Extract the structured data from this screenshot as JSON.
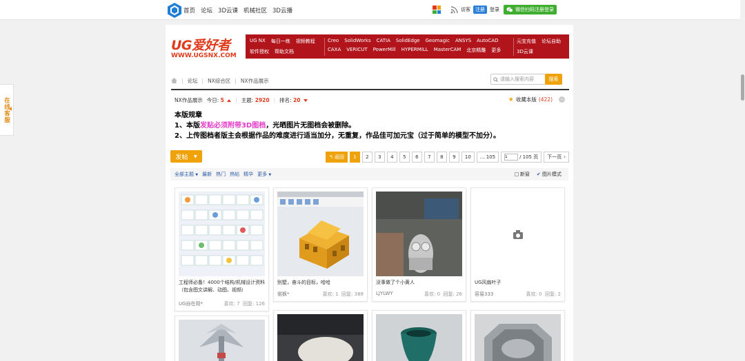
{
  "topbar": {
    "nav": [
      "首页",
      "论坛",
      "3D云课",
      "机械社区",
      "3D云播"
    ],
    "right_nav": [
      "访客",
      "注册",
      "登录"
    ],
    "wechat_label": "微信扫码注册登录"
  },
  "side_tab": {
    "label": "在线客服"
  },
  "brand": {
    "name": "UG爱好者",
    "url": "WWW.UGSNX.COM"
  },
  "redmenu": {
    "row1_a": [
      "UG NX",
      "每日一练",
      "视频教程"
    ],
    "row2_a": [
      "软件授权",
      "帮助文档"
    ],
    "row1_b": [
      "Creo",
      "SolidWorks",
      "CATIA",
      "SolidEdge",
      "Geomagic",
      "ANSYS",
      "AutoCAD"
    ],
    "row2_b": [
      "CAXA",
      "VERICUT",
      "PowerMill",
      "HYPERMILL",
      "MasterCAM",
      "北京精雕",
      "更多"
    ],
    "row1_c": [
      "元宝充值",
      "论坛自助"
    ],
    "row2_c": [
      "3D云课"
    ]
  },
  "breadcrumb": {
    "items": [
      "论坛",
      "NX综合区",
      "NX作品展示"
    ]
  },
  "search": {
    "placeholder": "请输入搜索内容",
    "button": "搜索"
  },
  "forum": {
    "name": "NX作品展示",
    "today_label": "今日:",
    "today_value": "5",
    "topics_label": "主题:",
    "topics_value": "2920",
    "rank_label": "排名:",
    "rank_value": "20",
    "fav_label": "收藏本版",
    "fav_count": "(422)"
  },
  "rules": {
    "title": "本版规章",
    "line1_pre": "1、本版",
    "line1_hl": "发贴必须附带3D图档",
    "line1_post": "，光晒图片无图档会被删除。",
    "line2": "2、上传图档者版主会根据作品的难度进行适当加分，无重复，作品佳可加元宝（过于简单的模型不加分）。"
  },
  "post_button": "发帖",
  "pager": {
    "back": "返回",
    "pages": [
      "1",
      "2",
      "3",
      "4",
      "5",
      "6",
      "7",
      "8",
      "9",
      "10",
      "... 105"
    ],
    "jump_value": "1",
    "jump_total": "/ 105 页",
    "next": "下一页"
  },
  "filter": {
    "items": [
      "全部主题",
      "最新",
      "热门",
      "热帖",
      "精华",
      "更多"
    ],
    "newwin": "新窗",
    "picmode": "图片模式"
  },
  "cards": [
    {
      "title": "工程师必备！4000个结构/机械设计资料（包含图文讲解、动图、视频）",
      "author": "UG自在观*",
      "likes": "喜欢: 7",
      "replies": "回复: 126"
    },
    {
      "title": "别墅，奋斗的目标，哈哈",
      "author": "偌枫*",
      "likes": "喜欢: 1",
      "replies": "回复: 388"
    },
    {
      "title": "没事做了个小黄人",
      "author": "LJYLWY",
      "likes": "喜欢: 0",
      "replies": "回复: 26"
    },
    {
      "title": "UG风扇叶子",
      "author": "容易333",
      "likes": "喜欢: 0",
      "replies": "回复: 2"
    }
  ],
  "colors": {
    "accent": "#f0a20b",
    "brand_red": "#b2141c",
    "highlight": "#e43bc8"
  }
}
